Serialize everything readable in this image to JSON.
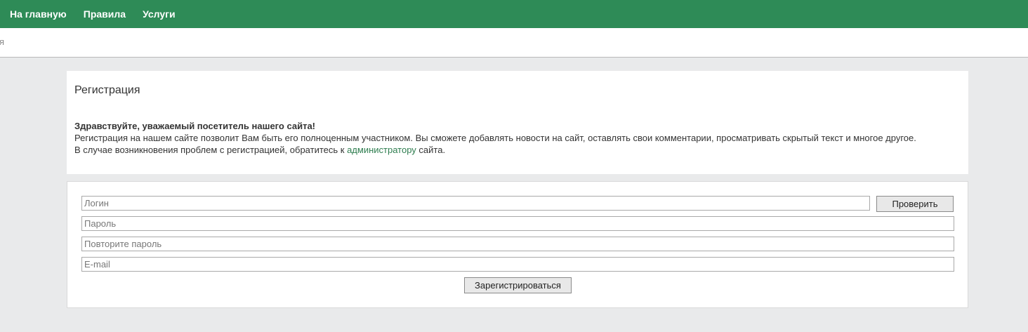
{
  "nav": {
    "items": [
      {
        "label": "На главную"
      },
      {
        "label": "Правила"
      },
      {
        "label": "Услуги"
      }
    ]
  },
  "subbar": {
    "text": "я"
  },
  "info": {
    "title": "Регистрация",
    "greeting": "Здравствуйте, уважаемый посетитель нашего сайта!",
    "body": "Регистрация на нашем сайте позволит Вам быть его полноценным участником. Вы сможете добавлять новости на сайт, оставлять свои комментарии, просматривать скрытый текст и многое другое.",
    "problem_prefix": "В случае возникновения проблем с регистрацией, обратитесь к ",
    "problem_link": "администратору",
    "problem_suffix": " сайта."
  },
  "form": {
    "login_placeholder": "Логин",
    "password_placeholder": "Пароль",
    "repeat_password_placeholder": "Повторите пароль",
    "email_placeholder": "E-mail",
    "check_button": "Проверить",
    "register_button": "Зарегистрироваться"
  },
  "colors": {
    "nav_bg": "#2e8b57",
    "link": "#2e7d4f",
    "page_bg": "#e9eaeb"
  }
}
